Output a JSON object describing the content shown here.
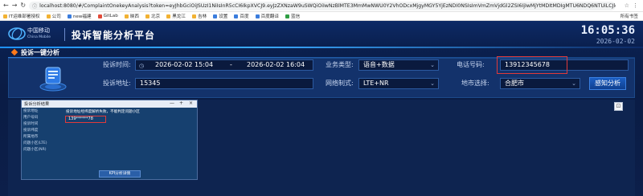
{
  "browser": {
    "url": "localhost:8080/#/ComplaintOnekeyAnalysis?token=eyJhbGciOiJSUzI1NiIsInR5cCI6IkpXVCJ9.eyJzZXNzaW9uSWQiOiIwNzBlMTE3MmMwNWU0Y2VhODcxMjgyMGY5YjEzNDI0NSIsImVmZmVjdGl2ZSI6IjIwMjYtMDItMDIgMTU6NDQ6NTUiLCJleHBp...",
    "bookmarks": [
      "IT运维部署授权",
      "公司",
      "new福建",
      "GitLab",
      "映西",
      "北京",
      "黑龙江",
      "吉林",
      "设置",
      "百度",
      "百度翻译",
      "蓝信"
    ],
    "bookmarks_right": "所有书签"
  },
  "header": {
    "logo_cn": "中国移动",
    "logo_en": "China Mobile",
    "title": "投诉智能分析平台",
    "time": "16:05:36",
    "date": "2026-02-02"
  },
  "section": {
    "title": "投诉一键分析"
  },
  "form": {
    "complaint_time_label": "投诉时间:",
    "time_start": "2026-02-02 15:04",
    "time_sep": "-",
    "time_end": "2026-02-02 16:04",
    "business_type_label": "业务类型:",
    "business_type_value": "语音+数据",
    "phone_label": "电话号码:",
    "phone_value": "13912345678",
    "address_label": "投诉地址:",
    "address_value": "15345",
    "network_label": "网络制式:",
    "network_value": "LTE+NR",
    "city_label": "地市选择:",
    "city_value": "合肥市",
    "analyze_button": "感知分析"
  },
  "dialog": {
    "title": "投诉分析结果",
    "row_labels": [
      "投诉地址",
      "用户号码",
      "投诉时间",
      "投诉纬度",
      "所属地市",
      "问题小区(LTE)",
      "问题小区(NR)"
    ],
    "message": "投诉地址经纬度解析失败，不能判定问题小区",
    "phone_masked": "139******78",
    "kpi_button": "KPI分析详情"
  },
  "colors": {
    "accent": "#1e90ff",
    "highlight_red": "#e03a3a",
    "section_dot": "#ff7a1a"
  }
}
